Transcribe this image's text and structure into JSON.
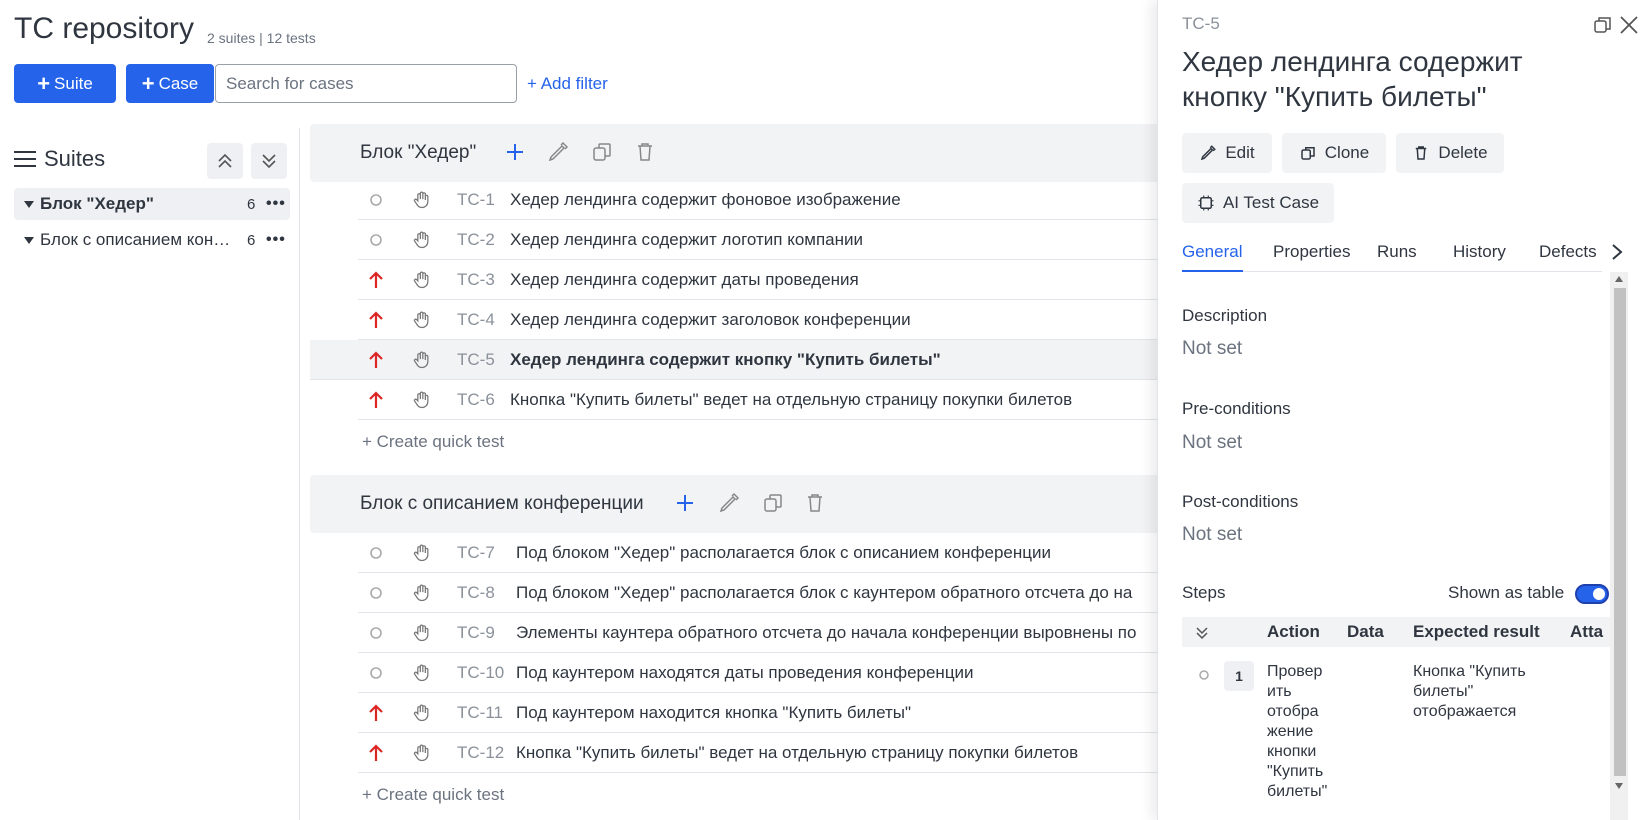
{
  "header": {
    "title": "TC repository",
    "meta": "2 suites | 12 tests",
    "suite_btn": "Suite",
    "case_btn": "Case",
    "search_placeholder": "Search for cases",
    "add_filter": "+ Add filter"
  },
  "sidebar": {
    "title": "Suites",
    "items": [
      {
        "name": "Блок \"Хедер\"",
        "count": "6"
      },
      {
        "name": "Блок с описанием конференции",
        "count": "6"
      }
    ]
  },
  "suites": [
    {
      "name": "Блок \"Хедер\"",
      "tests": [
        {
          "code": "TC-1",
          "name": "Хедер лендинга содержит фоновое изображение",
          "priority": "none"
        },
        {
          "code": "TC-2",
          "name": "Хедер лендинга содержит логотип компании",
          "priority": "none"
        },
        {
          "code": "TC-3",
          "name": "Хедер лендинга содержит даты проведения",
          "priority": "high"
        },
        {
          "code": "TC-4",
          "name": "Хедер лендинга содержит заголовок конференции",
          "priority": "high"
        },
        {
          "code": "TC-5",
          "name": "Хедер лендинга содержит кнопку \"Купить билеты\"",
          "priority": "high"
        },
        {
          "code": "TC-6",
          "name": "Кнопка \"Купить билеты\" ведет на отдельную страницу покупки билетов",
          "priority": "high"
        }
      ],
      "quick": "+ Create quick test"
    },
    {
      "name": "Блок с описанием конференции",
      "tests": [
        {
          "code": "TC-7",
          "name": "Под блоком \"Хедер\" располагается блок с описанием конференции",
          "priority": "none"
        },
        {
          "code": "TC-8",
          "name": "Под блоком \"Хедер\" располагается блок с каунтером обратного отсчета до на",
          "priority": "none"
        },
        {
          "code": "TC-9",
          "name": "Элементы каунтера обратного отсчета до начала конференции выровнены по",
          "priority": "none"
        },
        {
          "code": "TC-10",
          "name": "Под каунтером находятся даты проведения конференции",
          "priority": "none"
        },
        {
          "code": "TC-11",
          "name": "Под каунтером находится кнопка \"Купить билеты\"",
          "priority": "high"
        },
        {
          "code": "TC-12",
          "name": "Кнопка \"Купить билеты\" ведет на отдельную страницу покупки билетов",
          "priority": "high"
        }
      ],
      "quick": "+ Create quick test"
    }
  ],
  "panel": {
    "code": "TC-5",
    "title": "Хедер лендинга содержит кнопку \"Купить билеты\"",
    "edit": "Edit",
    "clone": "Clone",
    "delete": "Delete",
    "ai": "AI Test Case",
    "tabs": [
      "General",
      "Properties",
      "Runs",
      "History",
      "Defects"
    ],
    "description_label": "Description",
    "description_value": "Not set",
    "pre_label": "Pre-conditions",
    "pre_value": "Not set",
    "post_label": "Post-conditions",
    "post_value": "Not set",
    "steps_label": "Steps",
    "shown_as_table": "Shown as table",
    "cols": {
      "action": "Action",
      "data": "Data",
      "expected": "Expected result",
      "attach": "Atta"
    },
    "step": {
      "num": "1",
      "action": "Провер ить отобра жение кнопки \"Купить билеты\"",
      "expected": "Кнопка \"Купить билеты\" отображается"
    }
  },
  "colors": {
    "accent": "#2563eb",
    "priority_high": "#dc2626",
    "muted": "#8a919b"
  }
}
